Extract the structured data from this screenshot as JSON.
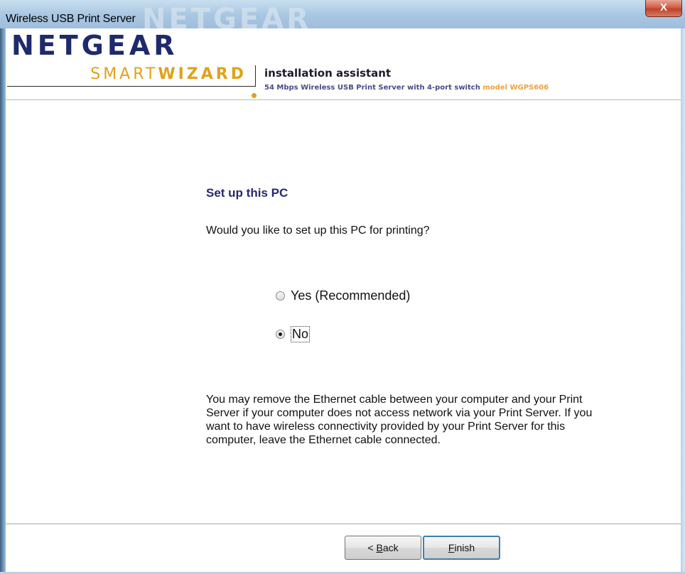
{
  "window": {
    "title": "Wireless USB Print Server",
    "title_ghost": "NETGEAR",
    "close_label": "X"
  },
  "header": {
    "logo_netgear": "NETGEAR",
    "logo_smart": "SMART",
    "logo_wizard": "WIZARD",
    "installation_title": "installation assistant",
    "subtitle": "54 Mbps Wireless USB Print Server with 4-port switch",
    "model": "model WGPS606"
  },
  "content": {
    "title": "Set up this PC",
    "question": "Would you like to set up this PC for printing?",
    "options": [
      {
        "label": "Yes (Recommended)",
        "checked": false
      },
      {
        "label": "No",
        "checked": true
      }
    ],
    "note": "You may remove the Ethernet cable between your computer and your Print Server if your computer does not access network via your Print Server.  If you want to have wireless connectivity provided by your Print Server for this computer, leave the Ethernet cable connected."
  },
  "footer": {
    "back_prefix": "< ",
    "back_accel": "B",
    "back_rest": "ack",
    "finish_accel": "F",
    "finish_rest": "inish"
  },
  "colors": {
    "brand_navy": "#1d2a6b",
    "brand_gold": "#e0a21a",
    "content_title": "#282870"
  }
}
